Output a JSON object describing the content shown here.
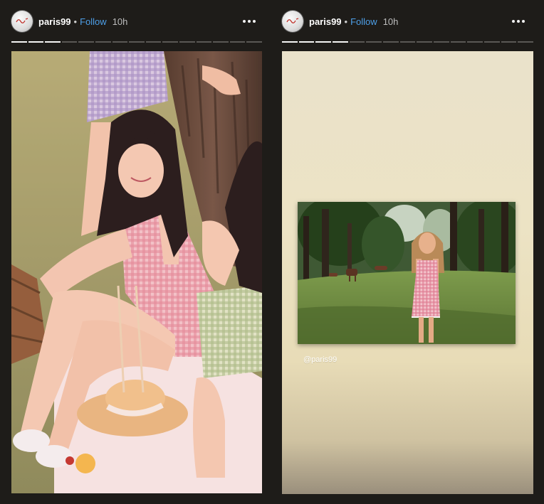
{
  "stories": [
    {
      "user": {
        "username": "paris99",
        "follow_label": "Follow",
        "separator": "•",
        "time": "10h"
      },
      "more_icon": "more-horizontal-icon",
      "progress": {
        "segments": 15,
        "completed": 3
      },
      "content": {
        "type": "photo",
        "description_icon": "story-photo"
      }
    },
    {
      "user": {
        "username": "paris99",
        "follow_label": "Follow",
        "separator": "•",
        "time": "10h"
      },
      "more_icon": "more-horizontal-icon",
      "progress": {
        "segments": 15,
        "completed": 4
      },
      "content": {
        "type": "reposted-photo",
        "mention": "@paris99"
      }
    }
  ],
  "colors": {
    "follow": "#4d9fe8",
    "background": "#1e1c19"
  }
}
